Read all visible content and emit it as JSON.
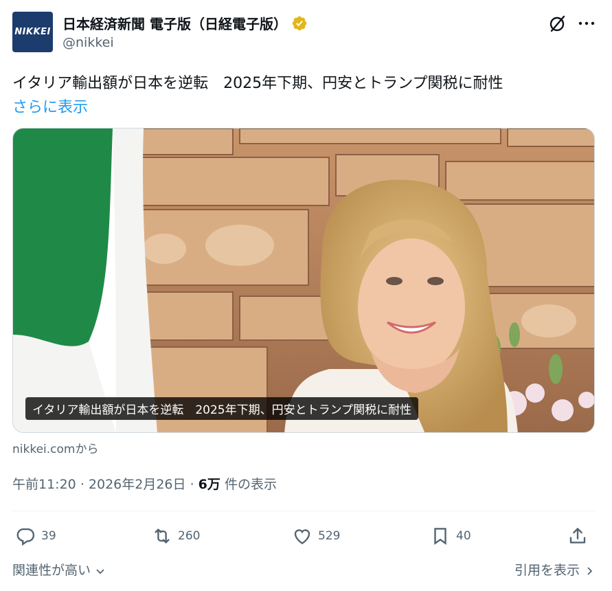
{
  "account": {
    "avatar_text": "NIKKEI",
    "display_name": "日本経済新聞 電子版（日経電子版）",
    "handle": "@nikkei",
    "verified_color": "#e2b719",
    "avatar_color": "#1b3c6d"
  },
  "tweet": {
    "text": "イタリア輸出額が日本を逆転　2025年下期、円安とトランプ関税に耐性",
    "show_more": "さらに表示"
  },
  "media": {
    "caption": "イタリア輸出額が日本を逆転　2025年下期、円安とトランプ関税に耐性"
  },
  "source": "nikkei.comから",
  "meta": {
    "time": "午前11:20",
    "sep": "·",
    "date": "2026年2月26日",
    "views_count": "6万",
    "views_label": "件の表示"
  },
  "actions": {
    "replies": "39",
    "retweets": "260",
    "likes": "529",
    "bookmarks": "40"
  },
  "footer": {
    "relevance": "関連性が高い",
    "quotes": "引用を表示"
  },
  "icons": [
    "grok-icon",
    "more-icon",
    "reply-icon",
    "retweet-icon",
    "like-icon",
    "bookmark-icon",
    "share-icon",
    "chevron-down-icon",
    "chevron-right-icon",
    "verified-badge-icon"
  ],
  "colors": {
    "accent": "#1d9bf0",
    "muted": "#536471",
    "text": "#0f1419"
  }
}
